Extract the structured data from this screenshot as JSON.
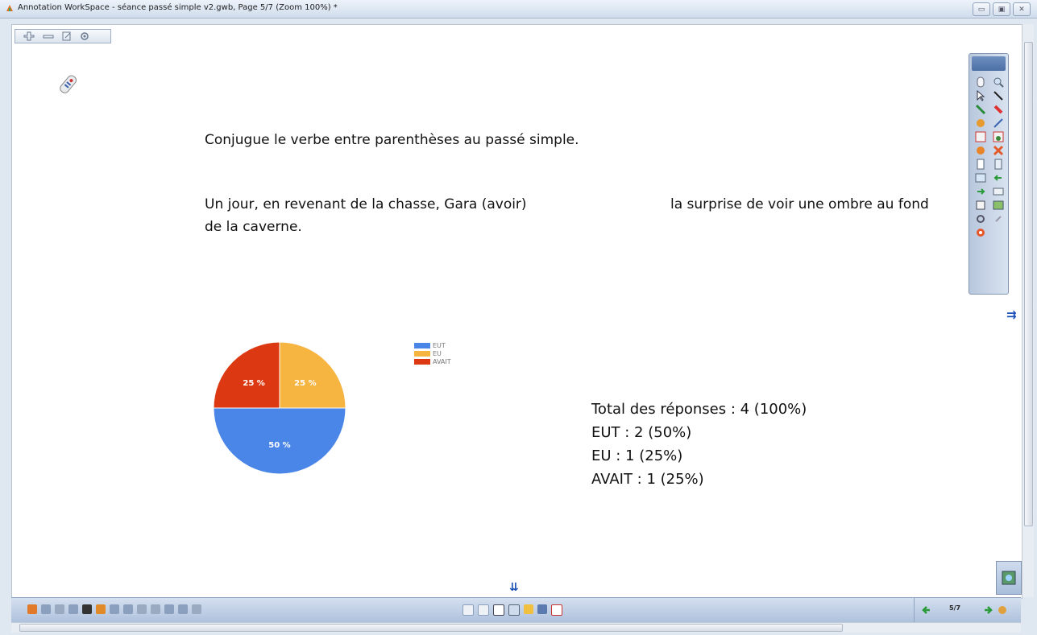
{
  "window": {
    "title": "Annotation WorkSpace - séance passé simple v2.gwb, Page 5/7  (Zoom 100%) *"
  },
  "content": {
    "instruction": "Conjugue le verbe entre parenthèses au passé simple.",
    "sentence_part1": "Un jour, en revenant de la chasse, Gara (avoir)",
    "sentence_part2": "la surprise de voir une ombre au fond",
    "sentence_part3": "de la caverne."
  },
  "stats": {
    "total": "Total des réponses : 4 (100%)",
    "eut": "EUT : 2 (50%)",
    "eu": "EU : 1 (25%)",
    "avait": "AVAIT : 1 (25%)"
  },
  "chart_data": {
    "type": "pie",
    "categories": [
      "EUT",
      "EU",
      "AVAIT"
    ],
    "values": [
      50,
      25,
      25
    ],
    "labels": [
      "50 %",
      "25 %",
      "25 %"
    ],
    "colors": [
      "#4a86e8",
      "#f6b440",
      "#dc3912"
    ],
    "legend_position": "right"
  },
  "navigation": {
    "page_indicator": "5/7"
  },
  "icons": {
    "app": "app-icon",
    "remote": "remote-icon",
    "next_page": "next-page-icon",
    "prev_page": "prev-page-icon"
  }
}
